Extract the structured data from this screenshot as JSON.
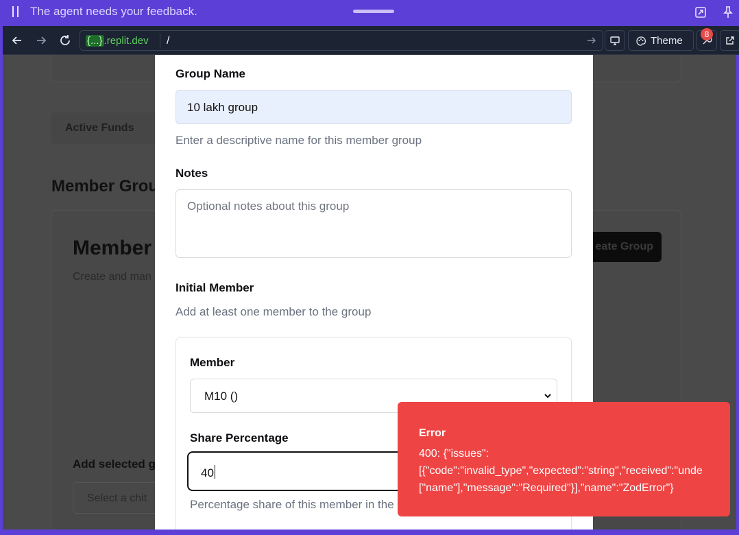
{
  "agent_banner": {
    "message": "The agent needs your feedback."
  },
  "browser": {
    "url_host_braces": "{...}",
    "url_host": ".replit.dev",
    "url_path": "/",
    "theme_label": "Theme",
    "notification_count": "8"
  },
  "background": {
    "tab_active_funds": "Active Funds",
    "section_title": "Member Grou",
    "card_title": "Member",
    "card_subtitle": "Create and man",
    "create_button": "eate Group",
    "add_selected_label": "Add selected g",
    "select_placeholder": "Select a chit"
  },
  "dialog": {
    "group_name_label": "Group Name",
    "group_name_value": "10 lakh group",
    "group_name_help": "Enter a descriptive name for this member group",
    "notes_label": "Notes",
    "notes_placeholder": "Optional notes about this group",
    "initial_member_label": "Initial Member",
    "initial_member_help": "Add at least one member to the group",
    "member_label": "Member",
    "member_value": "M10 ()",
    "share_label": "Share Percentage",
    "share_value": "40",
    "share_help": "Percentage share of this member in the"
  },
  "toast": {
    "title": "Error",
    "body": "400: {\"issues\":\n[{\"code\":\"invalid_type\",\"expected\":\"string\",\"received\":\"unde\n[\"name\"],\"message\":\"Required\"}],\"name\":\"ZodError\"}"
  },
  "colors": {
    "agent_banner": "#5b3fd6",
    "browser_bar": "#1c2333",
    "toast_error": "#ef4444",
    "input_highlight": "#e8f0fe"
  }
}
